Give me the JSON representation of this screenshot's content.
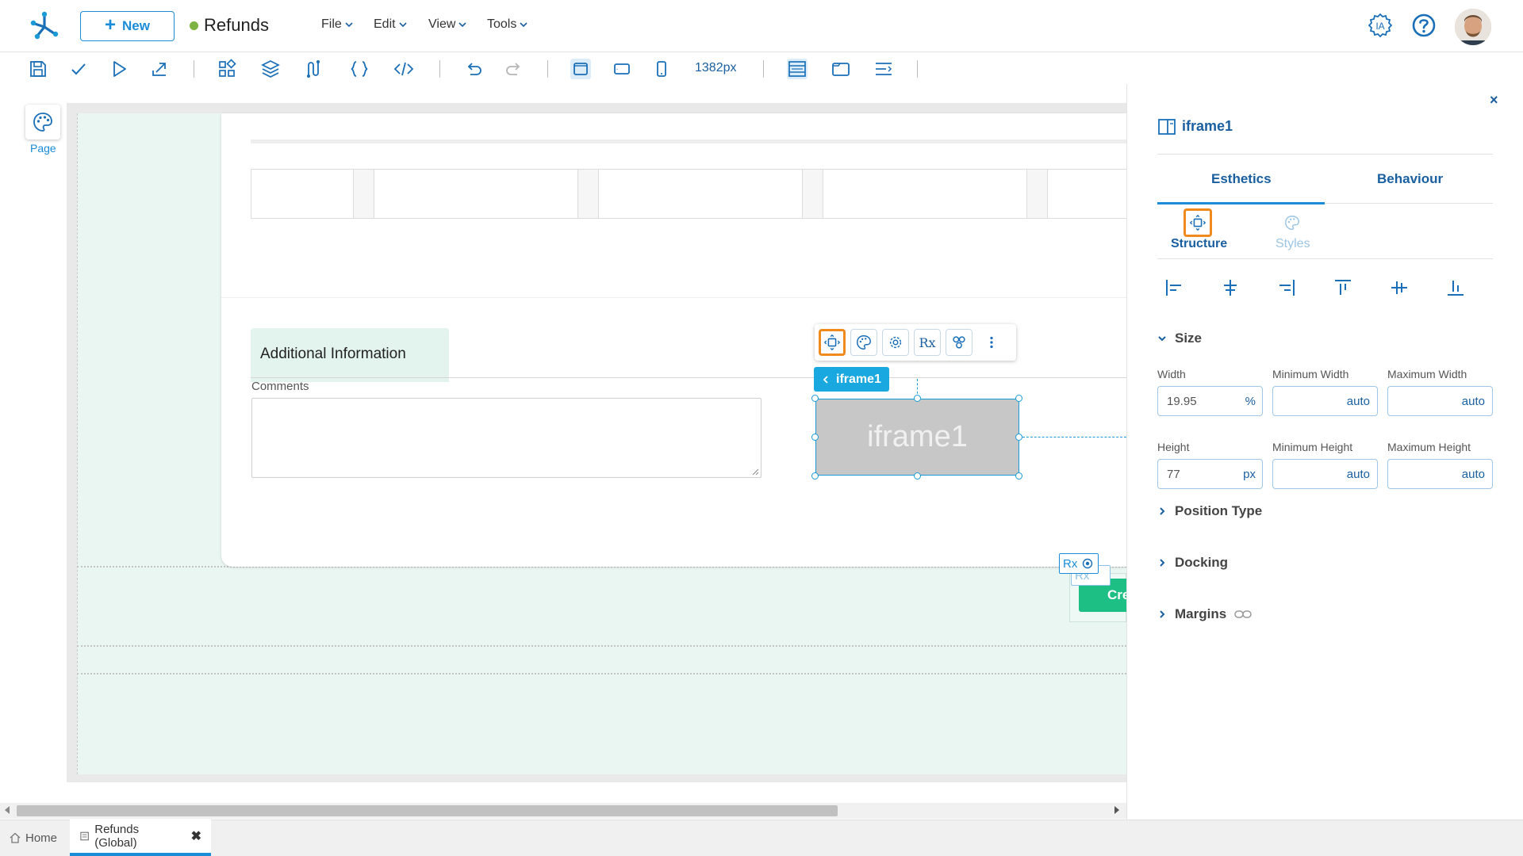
{
  "header": {
    "new_label": "New",
    "app_title": "Refunds",
    "status_color": "#7cb342",
    "menus": [
      "File",
      "Edit",
      "View",
      "Tools"
    ],
    "ia_label": "IA"
  },
  "toolbar": {
    "width_readout": "1382px",
    "icons": [
      "save-icon",
      "check-icon",
      "play-icon",
      "publish-icon",
      "components-icon",
      "layers-icon",
      "flow-icon",
      "braces-icon",
      "code-icon",
      "undo-icon",
      "redo-icon",
      "desktop-icon",
      "tablet-icon",
      "mobile-icon",
      "layout-icon",
      "window-icon",
      "align-icon"
    ]
  },
  "leftrail": {
    "page_label": "Page"
  },
  "canvas": {
    "section_title": "Additional Information",
    "comments_label": "Comments",
    "iframe_text": "iframe1",
    "breadcrumb": "iframe1",
    "rx_label": "Rx",
    "create_button_fragment": "Cre"
  },
  "bottom_tabs": {
    "home": "Home",
    "active_tab": "Refunds (Global)"
  },
  "panel": {
    "title": "iframe1",
    "close": "×",
    "tabs": [
      "Esthetics",
      "Behaviour"
    ],
    "subtabs": [
      "Structure",
      "Styles"
    ],
    "sections": {
      "size": "Size",
      "position_type": "Position Type",
      "docking": "Docking",
      "margins": "Margins"
    },
    "fields": {
      "width_label": "Width",
      "width_value": "19.95",
      "width_unit": "%",
      "min_width_label": "Minimum Width",
      "min_width_value": "auto",
      "max_width_label": "Maximum Width",
      "max_width_value": "auto",
      "height_label": "Height",
      "height_value": "77",
      "height_unit": "px",
      "min_height_label": "Minimum Height",
      "min_height_value": "auto",
      "max_height_label": "Maximum Height",
      "max_height_value": "auto"
    }
  },
  "colors": {
    "accent": "#1a8cd8",
    "highlight": "#f08a1c",
    "create_button": "#1dbf84"
  }
}
